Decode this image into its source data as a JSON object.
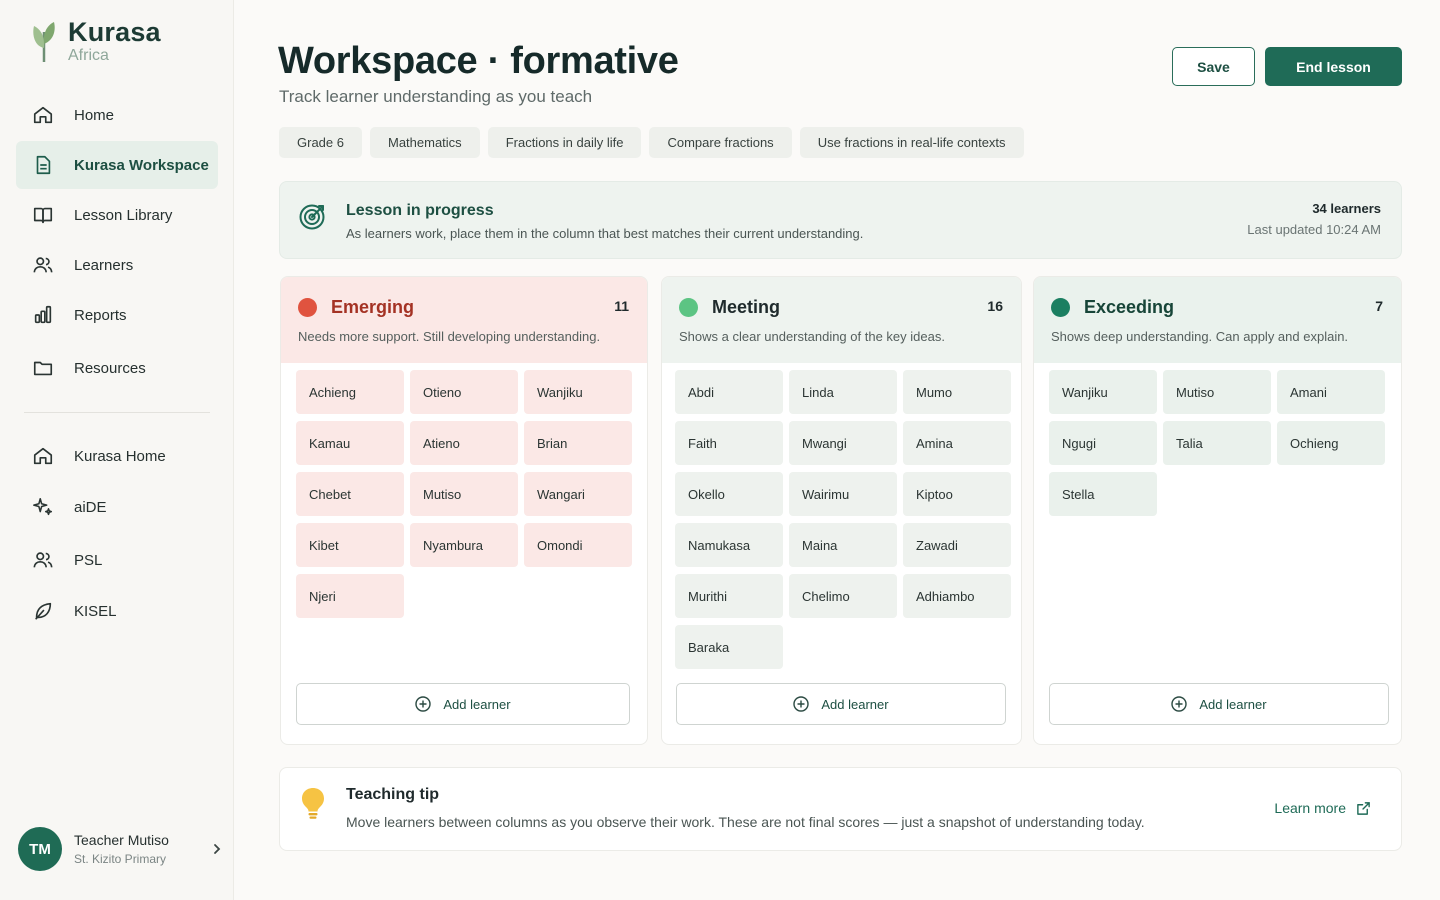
{
  "brand": {
    "name": "Kurasa",
    "sub": "Africa"
  },
  "sidebar": {
    "primary": [
      {
        "label": "Home",
        "icon": "home-icon"
      },
      {
        "label": "Kurasa Workspace",
        "icon": "document-icon",
        "active": true
      },
      {
        "label": "Lesson Library",
        "icon": "book-icon"
      },
      {
        "label": "Learners",
        "icon": "users-icon"
      },
      {
        "label": "Reports",
        "icon": "bar-chart-icon"
      },
      {
        "label": "Resources",
        "icon": "folder-icon"
      }
    ],
    "secondary": [
      {
        "label": "Kurasa Home",
        "icon": "home-icon"
      },
      {
        "label": "aiDE",
        "icon": "sparkle-icon"
      },
      {
        "label": "PSL",
        "icon": "users-icon"
      },
      {
        "label": "KISEL",
        "icon": "leaf-icon"
      }
    ],
    "profile": {
      "initials": "TM",
      "name": "Teacher Mutiso",
      "school": "St. Kizito Primary"
    }
  },
  "header": {
    "title": "Workspace · formative",
    "subtitle": "Track learner understanding as you teach",
    "save_label": "Save",
    "end_label": "End lesson"
  },
  "chips": [
    "Grade 6",
    "Mathematics",
    "Fractions in daily life",
    "Compare fractions",
    "Use fractions in real-life contexts"
  ],
  "banner": {
    "title": "Lesson in progress",
    "text": "As learners work, place them in the column that best matches their current understanding.",
    "count": "34 learners",
    "updated": "Last updated 10:24 AM"
  },
  "columns": {
    "emerging": {
      "title": "Emerging",
      "count": "11",
      "description": "Needs more support. Still developing understanding.",
      "learners": [
        "Achieng",
        "Otieno",
        "Wanjiku",
        "Kamau",
        "Atieno",
        "Brian",
        "Chebet",
        "Mutiso",
        "Wangari",
        "Kibet",
        "Nyambura",
        "Omondi",
        "Njeri"
      ],
      "add_label": "Add learner"
    },
    "meeting": {
      "title": "Meeting",
      "count": "16",
      "description": "Shows a clear understanding of the key ideas.",
      "learners": [
        "Abdi",
        "Linda",
        "Mumo",
        "Faith",
        "Mwangi",
        "Amina",
        "Okello",
        "Wairimu",
        "Kiptoo",
        "Namukasa",
        "Maina",
        "Zawadi",
        "Murithi",
        "Chelimo",
        "Adhiambo",
        "Baraka"
      ],
      "add_label": "Add learner"
    },
    "exceeding": {
      "title": "Exceeding",
      "count": "7",
      "description": "Shows deep understanding. Can apply and explain.",
      "learners": [
        "Wanjiku",
        "Mutiso",
        "Amani",
        "Ngugi",
        "Talia",
        "Ochieng",
        "Stella"
      ],
      "add_label": "Add learner"
    }
  },
  "tip": {
    "title": "Teaching tip",
    "text": "Move learners between columns as you observe their work. These are not final scores — just a snapshot of understanding today.",
    "link": "Learn more"
  },
  "colors": {
    "accent": "#1f6b57",
    "emerging": "#e0533f",
    "meeting": "#5cc483",
    "exceeding": "#1b7f61"
  }
}
